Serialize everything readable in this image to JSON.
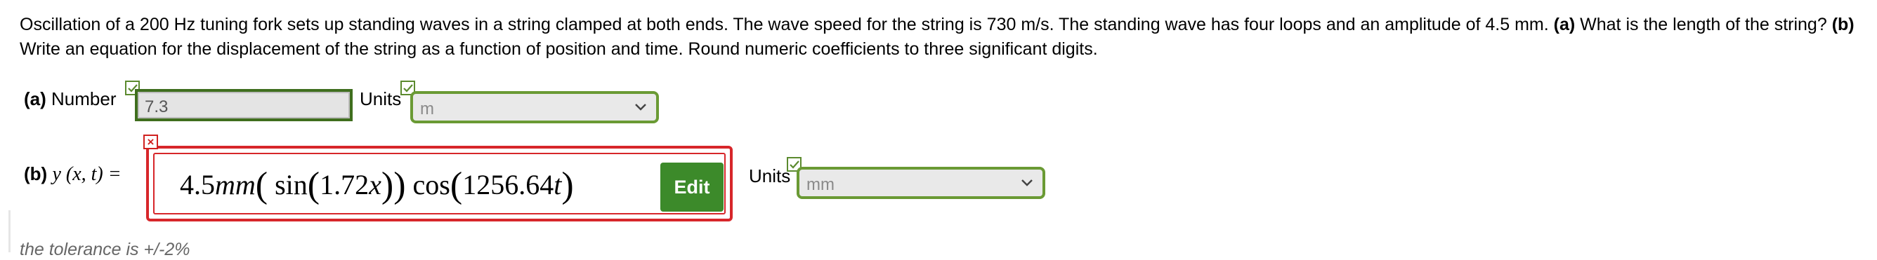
{
  "question": {
    "text_1": "Oscillation of a 200 Hz tuning fork sets up standing waves in a string clamped at both ends. The wave speed for the string is 730 m/s. The standing wave has four loops and an amplitude of 4.5 mm. ",
    "bold_a": "(a)",
    "text_2": " What is the length of the string? ",
    "bold_b": "(b)",
    "text_3": " Write an equation for the displacement of the string as a function of position and time. Round numeric coefficients to three significant digits."
  },
  "part_a": {
    "label_bold": "(a)",
    "label": "Number",
    "value": "7.3",
    "units_label": "Units",
    "units_value": "m"
  },
  "part_b": {
    "label_bold": "(b)",
    "label_math": "y (x, t) =",
    "expr_amp": "4.5",
    "expr_unit": "mm",
    "expr_sin": "sin",
    "expr_coef_x": "1.72",
    "expr_x": "x",
    "expr_cos": "cos",
    "expr_coef_t": "1256.64",
    "expr_t": "t",
    "edit_label": "Edit",
    "units_label": "Units",
    "units_value": "mm",
    "incorrect_mark": "×"
  },
  "tolerance": "the tolerance is +/-2%",
  "colors": {
    "correct": "#5b8a2e",
    "incorrect": "#d7262a",
    "edit_button": "#3c8a2a"
  },
  "icons": [
    "check-icon",
    "x-icon",
    "chevron-down-icon"
  ]
}
